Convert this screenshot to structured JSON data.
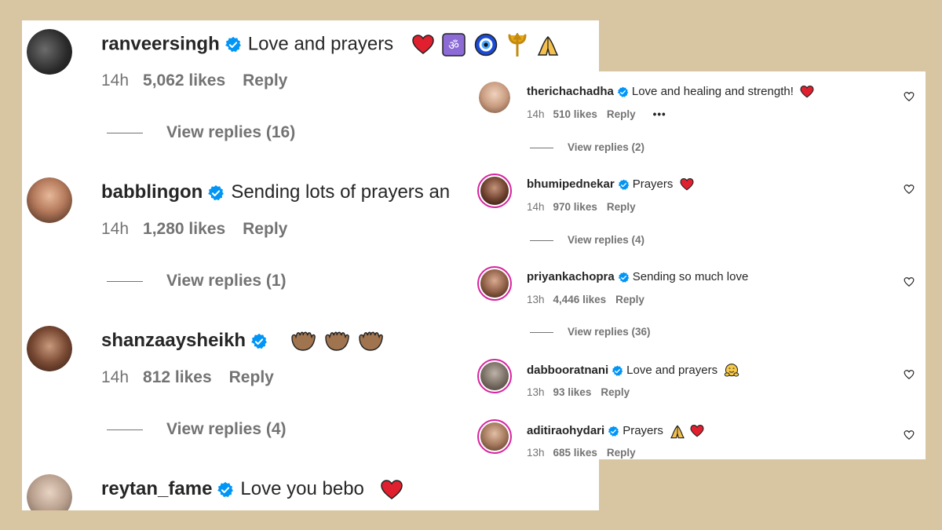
{
  "colors": {
    "background": "#d8c5a1",
    "verified": "#0095f6",
    "heart": "#e0202f",
    "text": "#262626",
    "meta": "#737373",
    "story_ring": "#d6249f"
  },
  "left_comments": [
    {
      "username": "ranveersingh",
      "text": "Love and prayers",
      "emojis": [
        "red-heart",
        "om-symbol",
        "nazar-amulet",
        "trident",
        "folded-hands"
      ],
      "time": "14h",
      "likes": "5,062 likes",
      "reply": "Reply",
      "view_replies": "View replies (16)"
    },
    {
      "username": "babblingon",
      "text": "Sending lots of prayers an",
      "emojis": [],
      "time": "14h",
      "likes": "1,280 likes",
      "reply": "Reply",
      "view_replies": "View replies (1)"
    },
    {
      "username": "shanzaaysheikh",
      "text": "",
      "emojis": [
        "palms-up",
        "palms-up",
        "palms-up"
      ],
      "time": "14h",
      "likes": "812 likes",
      "reply": "Reply",
      "view_replies": "View replies (4)"
    },
    {
      "username": "reytan_fame",
      "text": "Love you bebo",
      "emojis": [
        "red-heart"
      ]
    }
  ],
  "right_comments": [
    {
      "username": "therichachadha",
      "text": "Love and healing and strength!",
      "emojis": [
        "red-heart"
      ],
      "time": "14h",
      "likes": "510 likes",
      "reply": "Reply",
      "more": "•••",
      "view_replies": "View replies (2)"
    },
    {
      "username": "bhumipednekar",
      "text": "Prayers",
      "emojis": [
        "red-heart"
      ],
      "time": "14h",
      "likes": "970 likes",
      "reply": "Reply",
      "view_replies": "View replies (4)"
    },
    {
      "username": "priyankachopra",
      "text": "Sending so much love",
      "emojis": [],
      "time": "13h",
      "likes": "4,446 likes",
      "reply": "Reply",
      "view_replies": "View replies (36)"
    },
    {
      "username": "dabbooratnani",
      "text": "Love and prayers",
      "emojis": [
        "hugging-face"
      ],
      "time": "13h",
      "likes": "93 likes",
      "reply": "Reply"
    },
    {
      "username": "aditiraohydari",
      "text": "Prayers",
      "emojis": [
        "folded-hands",
        "red-heart"
      ],
      "time": "13h",
      "likes": "685 likes",
      "reply": "Reply"
    }
  ],
  "icons": {
    "verified": "verified-badge-icon",
    "like": "heart-outline-icon"
  }
}
